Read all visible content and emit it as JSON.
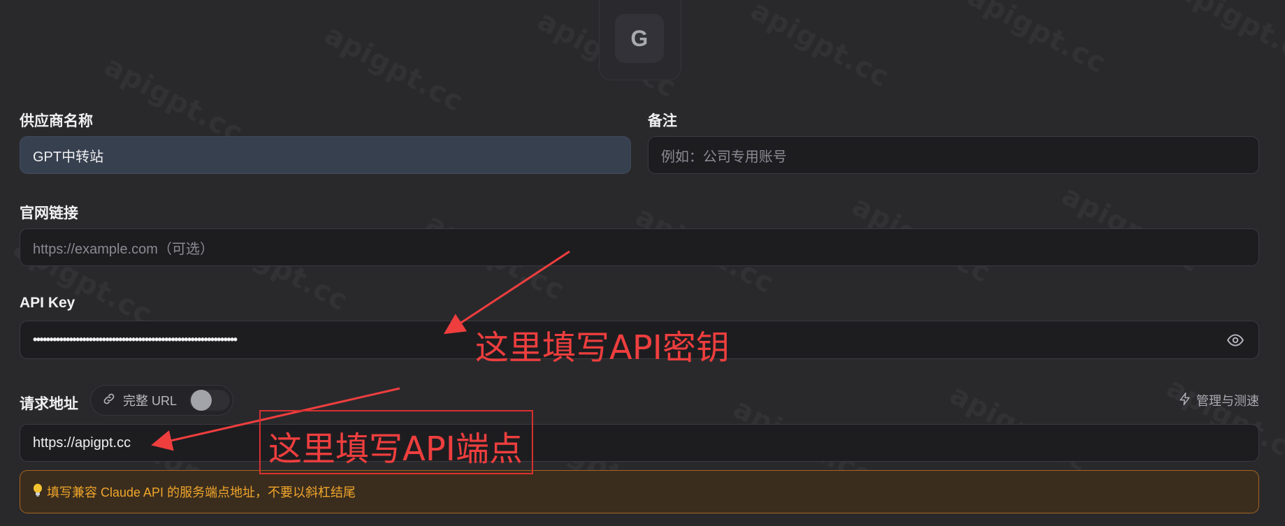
{
  "avatar": {
    "letter": "G"
  },
  "fields": {
    "provider_name": {
      "label": "供应商名称",
      "value": "GPT中转站"
    },
    "note": {
      "label": "备注",
      "placeholder": "例如：公司专用账号"
    },
    "website": {
      "label": "官网链接",
      "placeholder": "https://example.com（可选）"
    },
    "api_key": {
      "label": "API Key",
      "masked_value": "••••••••••••••••••••••••••••••••••••••••••••••••••••••••••••••"
    },
    "endpoint": {
      "label": "请求地址",
      "full_url_toggle": {
        "label": "完整 URL",
        "state": "off"
      },
      "manage_link": "管理与测速",
      "value": "https://apigpt.cc"
    }
  },
  "hint": {
    "text": "填写兼容 Claude API 的服务端点地址，不要以斜杠结尾"
  },
  "annotations": {
    "api_key_note": "这里填写API密钥",
    "endpoint_note": "这里填写API端点"
  },
  "watermark": "apigpt.cc",
  "colors": {
    "annotation": "#ee3e3e",
    "hint_border": "#a8651f",
    "hint_text": "#f0a52a"
  }
}
